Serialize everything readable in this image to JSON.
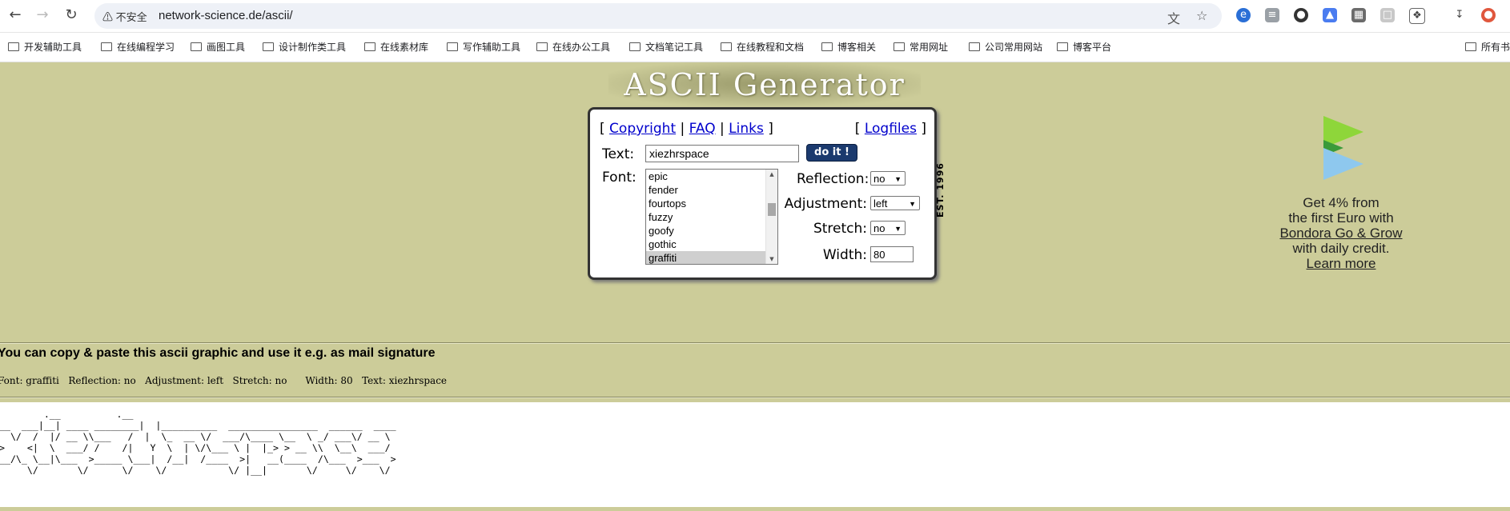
{
  "browser": {
    "security_label": "不安全",
    "url": "network-science.de/ascii/",
    "bookmarks": [
      "开发辅助工具",
      "在线编程学习",
      "画图工具",
      "设计制作类工具",
      "在线素材库",
      "写作辅助工具",
      "在线办公工具",
      "文档笔记工具",
      "在线教程和文档",
      "博客相关",
      "常用网址",
      "公司常用网站",
      "博客平台",
      "所有书"
    ]
  },
  "page": {
    "title": "ASCII Generator",
    "est_badge": "EST. 1996"
  },
  "form": {
    "nav": {
      "copyright": "Copyright",
      "faq": "FAQ",
      "links": "Links",
      "logfiles": "Logfiles"
    },
    "text_label": "Text:",
    "text_value": "xiezhrspace",
    "submit_label": "do it !",
    "font_label": "Font:",
    "font_options": [
      "epic",
      "fender",
      "fourtops",
      "fuzzy",
      "goofy",
      "gothic",
      "graffiti"
    ],
    "font_selected": "graffiti",
    "reflection_label": "Reflection:",
    "reflection_value": "no",
    "adjustment_label": "Adjustment:",
    "adjustment_value": "left",
    "stretch_label": "Stretch:",
    "stretch_value": "no",
    "width_label": "Width:",
    "width_value": "80"
  },
  "ad": {
    "line1": "Get 4% from",
    "line2": "the first Euro with",
    "link": "Bondora Go & Grow",
    "line3": "with daily credit.",
    "learn_more": "Learn more",
    "colors": {
      "light_green": "#8ed63a",
      "dark_green": "#3a9a3a",
      "blue": "#8ec8ee"
    }
  },
  "result": {
    "copy_hint": "You can copy & paste this ascii graphic and use it e.g. as mail signature",
    "settings_line": "Font: graffiti   Reflection: no   Adjustment: left   Stretch: no      Width: 80   Text: xiezhrspace",
    "ascii_art": "         .__          .__\n___  ___|__| ____ ________|  |__________  ________________  ______  ____\n\\  \\/  /  |/ __ \\\\___   /  |  \\_  __ \\/  ___/\\____ \\__  \\ _/ ___\\/ __ \\\n >    <|  \\  ___/ /    /|   Y  \\  | \\/\\___ \\ |  |_> > __ \\\\  \\__\\  ___/\n/__/\\_ \\__|\\___  >_____ \\___|  /__|  /____  >|   __(____  /\\___  >___  >\n      \\/       \\/      \\/    \\/           \\/ |__|       \\/     \\/    \\/"
  }
}
